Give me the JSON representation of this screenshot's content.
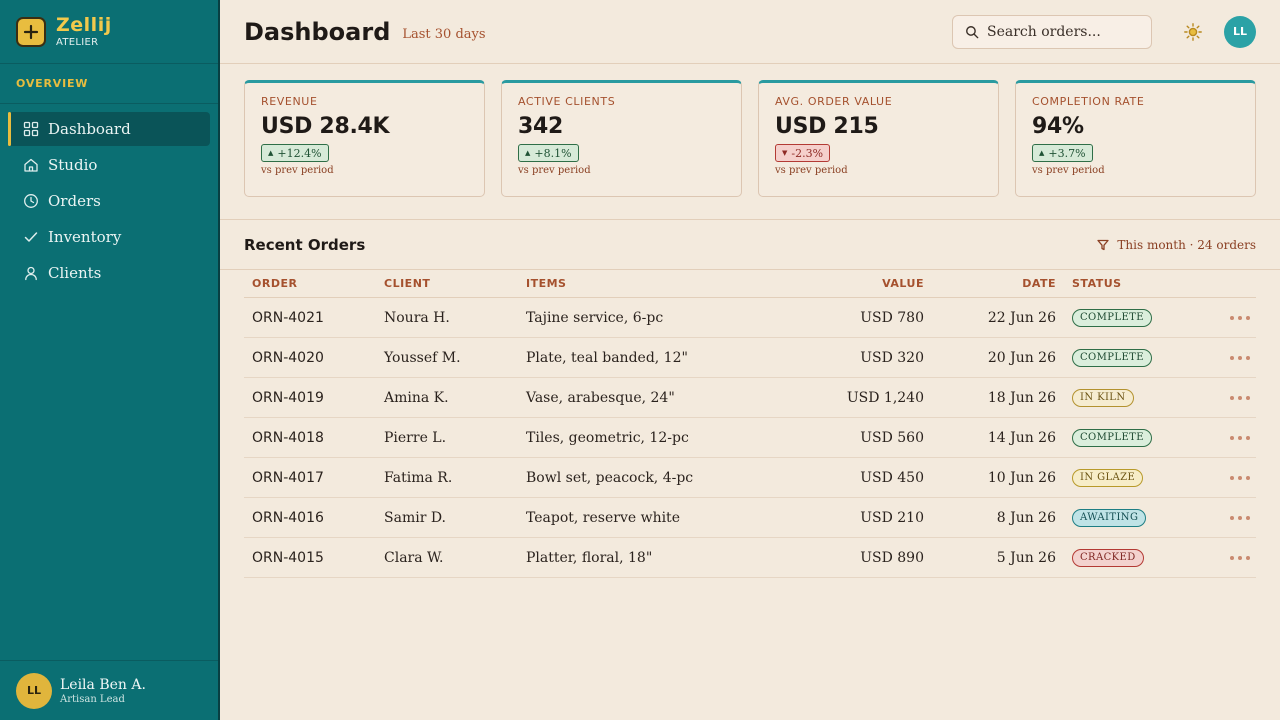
{
  "brand": {
    "name": "Zellij",
    "sub": "ATELIER",
    "icon": "plus-icon"
  },
  "sidebar": {
    "section": "OVERVIEW",
    "items": [
      {
        "label": "Dashboard",
        "icon": "grid-icon",
        "active": true
      },
      {
        "label": "Studio",
        "icon": "home-icon"
      },
      {
        "label": "Orders",
        "icon": "clock-icon"
      },
      {
        "label": "Inventory",
        "icon": "check-icon"
      },
      {
        "label": "Clients",
        "icon": "user-icon"
      }
    ],
    "user": {
      "initials": "LL",
      "name": "Leila Ben A.",
      "role": "Artisan Lead"
    }
  },
  "header": {
    "title": "Dashboard",
    "subtitle": "Last 30 days",
    "search_placeholder": "Search orders...",
    "avatar_initials": "LL"
  },
  "kpis": [
    {
      "label": "REVENUE",
      "value": "USD 28.4K",
      "delta": "+12.4%",
      "direction": "up",
      "note": "vs prev period"
    },
    {
      "label": "ACTIVE CLIENTS",
      "value": "342",
      "delta": "+8.1%",
      "direction": "up",
      "note": "vs prev period"
    },
    {
      "label": "AVG. ORDER VALUE",
      "value": "USD 215",
      "delta": "-2.3%",
      "direction": "down",
      "note": "vs prev period"
    },
    {
      "label": "COMPLETION RATE",
      "value": "94%",
      "delta": "+3.7%",
      "direction": "up",
      "note": "vs prev period"
    }
  ],
  "orders": {
    "title": "Recent Orders",
    "filter": "This month · 24 orders",
    "columns": {
      "order": "ORDER",
      "client": "CLIENT",
      "items": "ITEMS",
      "value": "VALUE",
      "date": "DATE",
      "status": "STATUS"
    },
    "rows": [
      {
        "order": "ORN-4021",
        "client": "Noura H.",
        "items": "Tajine service, 6-pc",
        "value": "USD 780",
        "date": "22 Jun 26",
        "status": "COMPLETE",
        "kind": "complete"
      },
      {
        "order": "ORN-4020",
        "client": "Youssef M.",
        "items": "Plate, teal banded, 12\"",
        "value": "USD 320",
        "date": "20 Jun 26",
        "status": "COMPLETE",
        "kind": "complete"
      },
      {
        "order": "ORN-4019",
        "client": "Amina K.",
        "items": "Vase, arabesque, 24\"",
        "value": "USD 1,240",
        "date": "18 Jun 26",
        "status": "IN KILN",
        "kind": "kiln"
      },
      {
        "order": "ORN-4018",
        "client": "Pierre L.",
        "items": "Tiles, geometric, 12-pc",
        "value": "USD 560",
        "date": "14 Jun 26",
        "status": "COMPLETE",
        "kind": "complete"
      },
      {
        "order": "ORN-4017",
        "client": "Fatima R.",
        "items": "Bowl set, peacock, 4-pc",
        "value": "USD 450",
        "date": "10 Jun 26",
        "status": "IN GLAZE",
        "kind": "glaze"
      },
      {
        "order": "ORN-4016",
        "client": "Samir D.",
        "items": "Teapot, reserve white",
        "value": "USD 210",
        "date": "8 Jun 26",
        "status": "AWAITING",
        "kind": "awaiting"
      },
      {
        "order": "ORN-4015",
        "client": "Clara W.",
        "items": "Platter, floral, 18\"",
        "value": "USD 890",
        "date": "5 Jun 26",
        "status": "CRACKED",
        "kind": "cracked"
      }
    ]
  },
  "colors": {
    "sidebar": "#0b6f73",
    "accent": "#e8bd3f",
    "background": "#f3eadd",
    "kpi_top": "#2a9aa0"
  }
}
